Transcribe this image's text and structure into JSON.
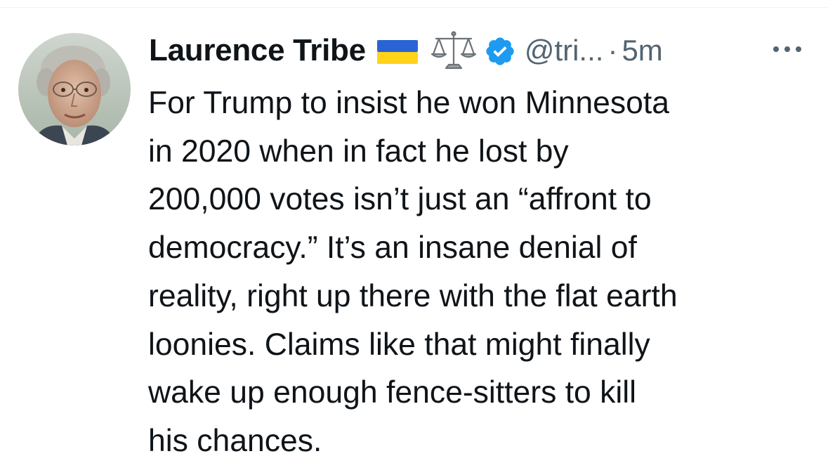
{
  "tweet": {
    "author": {
      "display_name": "Laurence Tribe",
      "handle": "@tri...",
      "avatar_icon": "person-avatar-icon",
      "badges": [
        "ukraine-flag-icon",
        "balance-scale-icon",
        "verified-badge-icon"
      ]
    },
    "separator": "·",
    "timestamp": "5m",
    "more_icon": "more-options-icon",
    "text_lines": [
      "For Trump to insist he won Minnesota",
      "in 2020 when in fact he lost by",
      "200,000 votes isn’t just an “affront to",
      "democracy.” It’s an insane denial of",
      "reality, right up there with the flat earth",
      "loonies. Claims like that might finally",
      "wake up enough fence-sitters to kill",
      "his chances."
    ]
  },
  "colors": {
    "text_primary": "#0f1419",
    "text_secondary": "#536471",
    "verified_blue": "#1d9bf0",
    "flag_blue": "#2a63d6",
    "flag_yellow": "#ffd31a",
    "divider": "#eff3f4"
  }
}
